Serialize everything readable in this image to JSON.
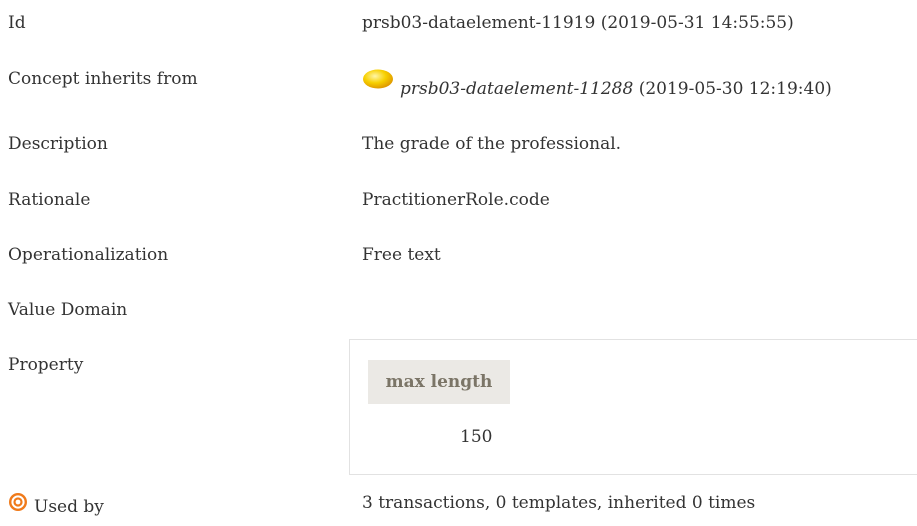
{
  "rows": {
    "id": {
      "label": "Id",
      "value": "prsb03-dataelement-11919 (2019-05-31 14:55:55)"
    },
    "inherits": {
      "label": "Concept inherits from",
      "ref_id": "prsb03-dataelement-11288",
      "ref_date": " (2019-05-30 12:19:40)",
      "icon": "yellow-circle-icon"
    },
    "description": {
      "label": "Description",
      "value": "The grade of the professional."
    },
    "rationale": {
      "label": "Rationale",
      "value": "PractitionerRole.code"
    },
    "operationalization": {
      "label": "Operationalization",
      "value": "Free text"
    },
    "value_domain": {
      "label": "Value Domain"
    },
    "property": {
      "label": "Property",
      "header": "max length",
      "value": "150"
    },
    "used_by": {
      "label": "Used by",
      "icon": "target-icon",
      "value": "3 transactions, 0 templates, inherited 0 times"
    }
  },
  "colors": {
    "text": "#333333",
    "header_bg": "#ebe9e5",
    "header_text": "#7b7567",
    "border": "#e2e2e2",
    "concept_dot": "#f5c400",
    "target_icon": "#f07a1a"
  }
}
